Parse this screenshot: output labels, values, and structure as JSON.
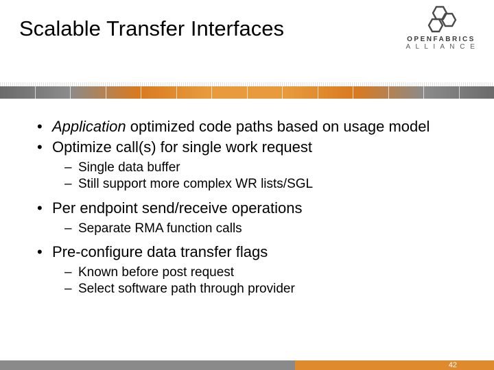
{
  "header": {
    "title": "Scalable Transfer Interfaces",
    "logo_top": "OPENFABRICS",
    "logo_bottom": "A L L I A N C E"
  },
  "bullets": [
    {
      "prefix_italic": "Application",
      "rest": " optimized code paths based on usage model",
      "sub": []
    },
    {
      "text": "Optimize call(s) for single work request",
      "sub": [
        "Single data buffer",
        "Still support more complex WR lists/SGL"
      ]
    },
    {
      "text": "Per endpoint send/receive operations",
      "sub": [
        "Separate RMA function calls"
      ]
    },
    {
      "text": "Pre-configure data transfer flags",
      "sub": [
        "Known before post request",
        "Select software path through provider"
      ]
    }
  ],
  "page": "42"
}
